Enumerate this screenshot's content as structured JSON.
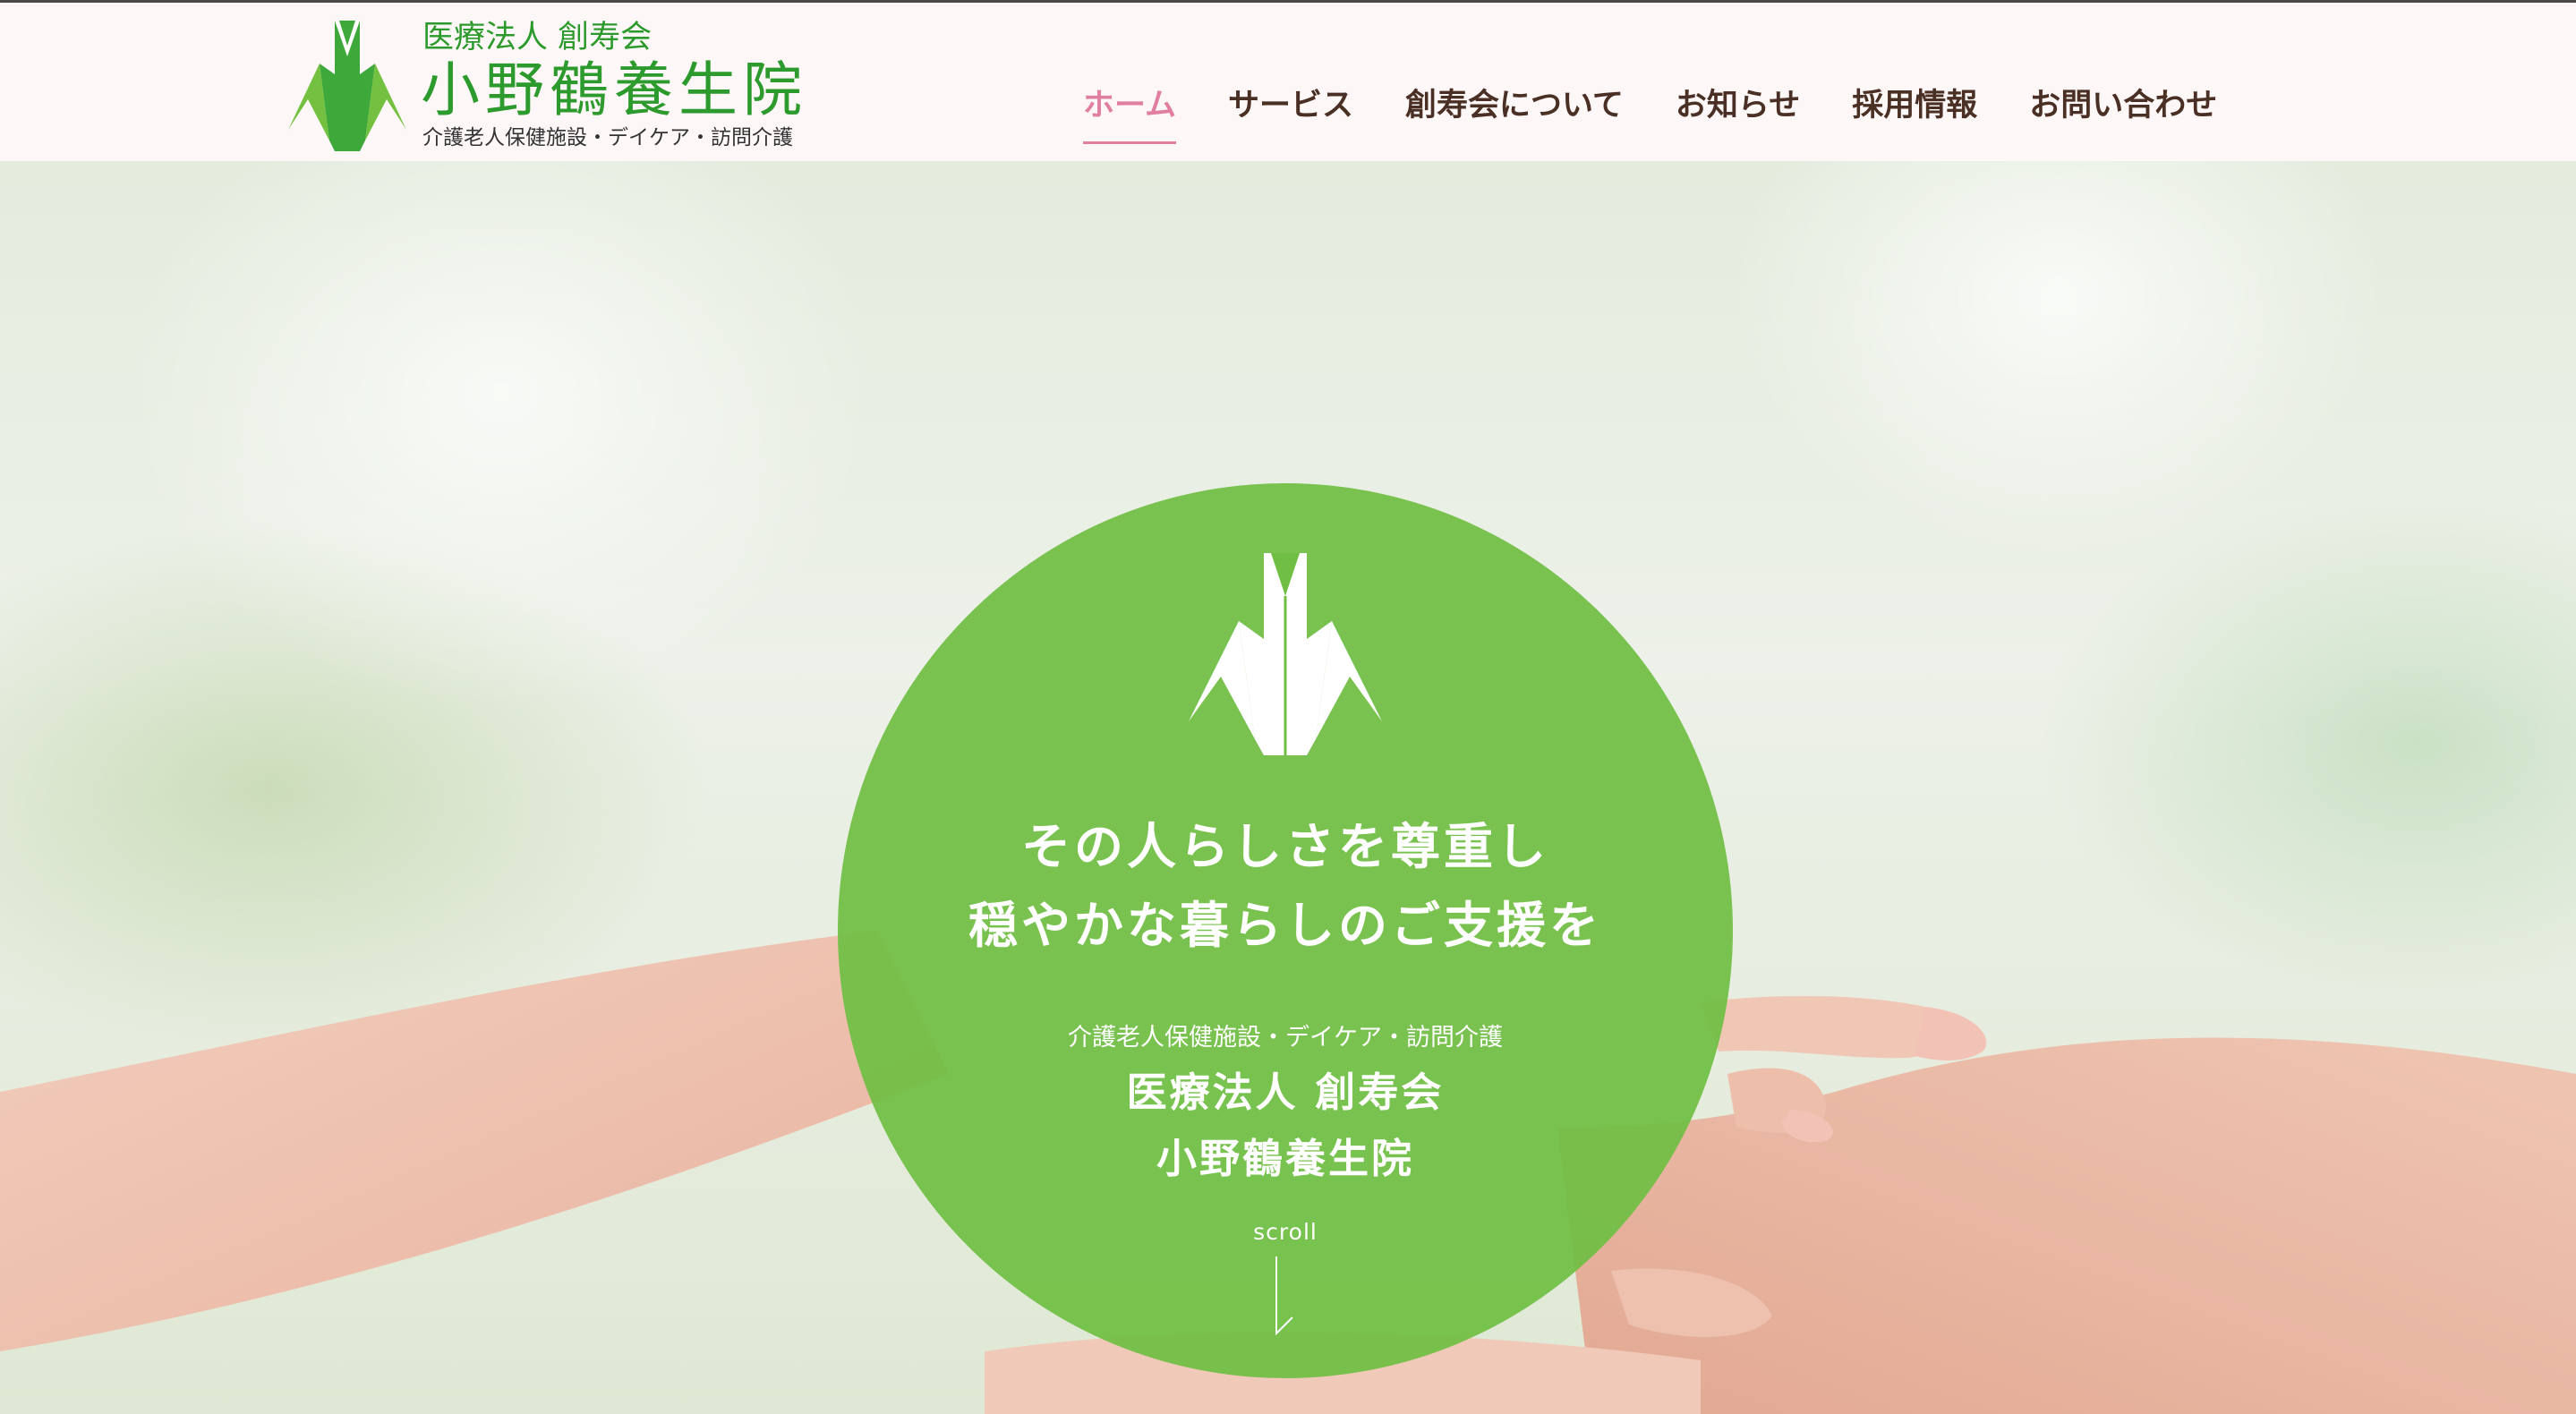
{
  "header": {
    "logo": {
      "corp_name": "医療法人 創寿会",
      "facility_name": "小野鶴養生院",
      "subtitle": "介護老人保健施設・デイケア・訪問介護",
      "icon": "crane-icon",
      "color": "#2c9a2c"
    },
    "nav": {
      "items": [
        {
          "label": "ホーム",
          "active": true
        },
        {
          "label": "サービス",
          "active": false
        },
        {
          "label": "創寿会について",
          "active": false
        },
        {
          "label": "お知らせ",
          "active": false
        },
        {
          "label": "採用情報",
          "active": false
        },
        {
          "label": "お問い合わせ",
          "active": false
        }
      ],
      "active_color": "#e07fa0",
      "text_color": "#4a3024"
    }
  },
  "hero": {
    "tagline_line1": "その人らしさを尊重し",
    "tagline_line2": "穏やかな暮らしのご支援を",
    "services": "介護老人保健施設・デイケア・訪問介護",
    "corp_name": "医療法人 創寿会",
    "facility_name": "小野鶴養生院",
    "scroll_label": "scroll",
    "circle_color": "#70be44",
    "icon": "crane-icon",
    "background": "hands-photo"
  }
}
